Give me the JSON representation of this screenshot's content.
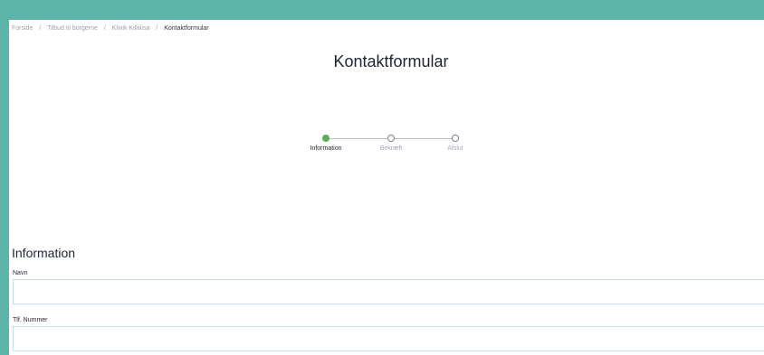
{
  "breadcrumb": {
    "items": [
      "Forside",
      "Tilbud til borgerne",
      "Klinik Killiliisa"
    ],
    "current": "Kontaktformular",
    "separator": "/"
  },
  "page": {
    "title": "Kontaktformular"
  },
  "stepper": {
    "active_color": "#5cab5a",
    "steps": [
      {
        "label": "Information",
        "active": true
      },
      {
        "label": "Bekræft",
        "active": false
      },
      {
        "label": "Afslut",
        "active": false
      }
    ]
  },
  "form": {
    "section_title": "Information",
    "fields": [
      {
        "label": "Navn",
        "value": "",
        "placeholder": ""
      },
      {
        "label": "Tlf. Nummer",
        "value": "",
        "placeholder": ""
      }
    ]
  },
  "colors": {
    "background": "#5db5aa",
    "page": "#ffffff",
    "input_border": "#c8dcea"
  }
}
